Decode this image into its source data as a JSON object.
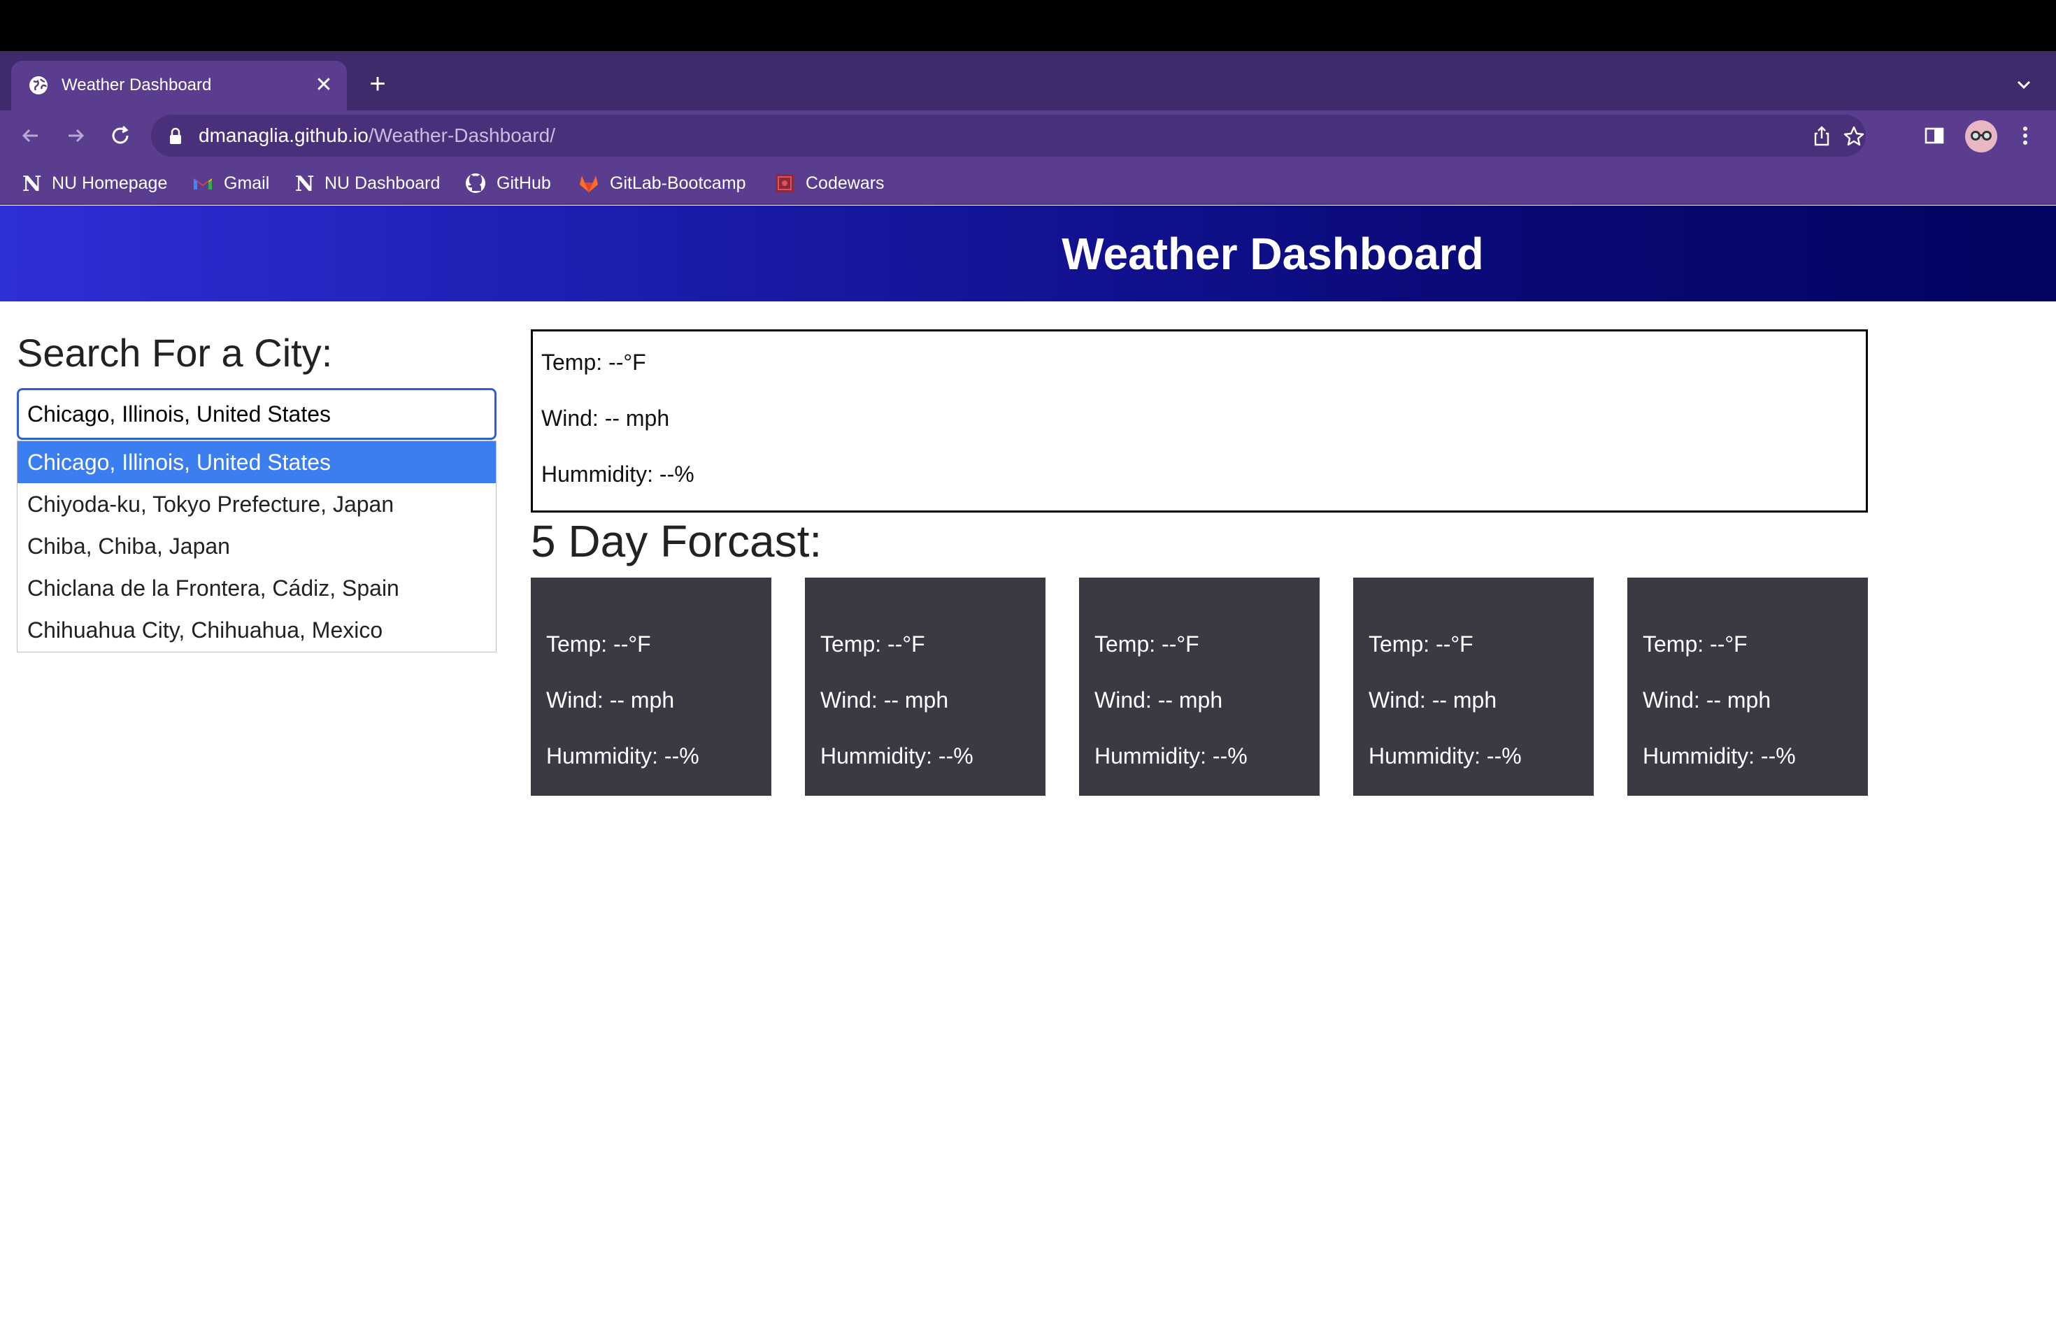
{
  "browser": {
    "tab_title": "Weather Dashboard",
    "url_host": "dmanaglia.github.io",
    "url_path": "/Weather-Dashboard/",
    "accent_color": "#5a3d8f",
    "bookmarks": [
      {
        "label": "NU Homepage",
        "icon": "notion-icon"
      },
      {
        "label": "Gmail",
        "icon": "gmail-icon"
      },
      {
        "label": "NU Dashboard",
        "icon": "notion-icon"
      },
      {
        "label": "GitHub",
        "icon": "github-icon"
      },
      {
        "label": "GitLab-Bootcamp",
        "icon": "gitlab-icon"
      },
      {
        "label": "Codewars",
        "icon": "codewars-icon"
      }
    ]
  },
  "header": {
    "title": "Weather Dashboard"
  },
  "search": {
    "heading": "Search For a City:",
    "value": "Chicago, Illinois, United States",
    "suggestions": [
      "Chicago, Illinois, United States",
      "Chiyoda-ku, Tokyo Prefecture, Japan",
      "Chiba, Chiba, Japan",
      "Chiclana de la Frontera, Cádiz, Spain",
      "Chihuahua City, Chihuahua, Mexico"
    ],
    "highlight_color": "#3a7ef0"
  },
  "current": {
    "temp": "Temp: --°F",
    "wind": "Wind: -- mph",
    "humidity": "Hummidity: --%"
  },
  "forecast": {
    "heading": "5 Day Forcast:",
    "card_color": "#3a3a44",
    "days": [
      {
        "temp": "Temp: --°F",
        "wind": "Wind: -- mph",
        "humidity": "Hummidity: --%"
      },
      {
        "temp": "Temp: --°F",
        "wind": "Wind: -- mph",
        "humidity": "Hummidity: --%"
      },
      {
        "temp": "Temp: --°F",
        "wind": "Wind: -- mph",
        "humidity": "Hummidity: --%"
      },
      {
        "temp": "Temp: --°F",
        "wind": "Wind: -- mph",
        "humidity": "Hummidity: --%"
      },
      {
        "temp": "Temp: --°F",
        "wind": "Wind: -- mph",
        "humidity": "Hummidity: --%"
      }
    ]
  }
}
